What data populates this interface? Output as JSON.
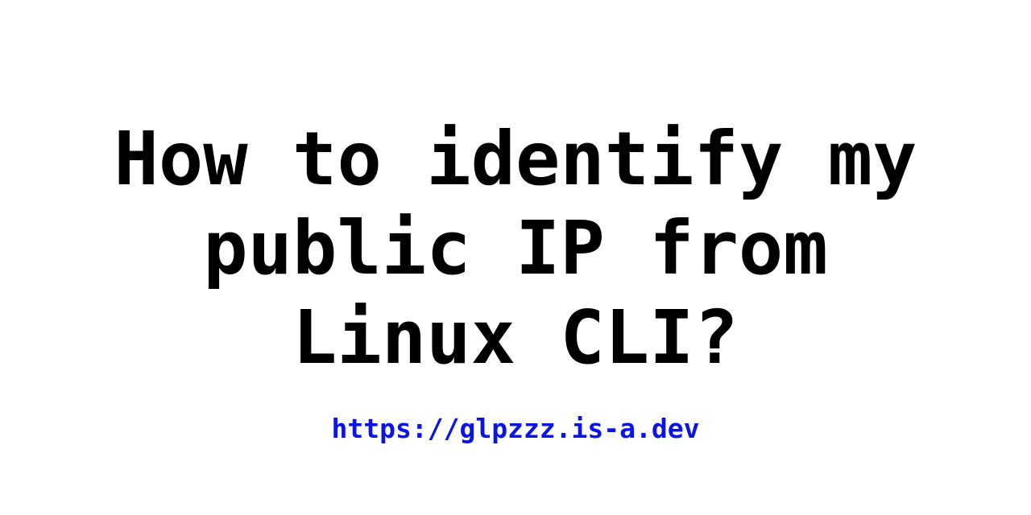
{
  "title": {
    "lines": [
      "How to identify my",
      "public IP from",
      "Linux CLI?"
    ],
    "color": "#000000"
  },
  "link": {
    "text": "https://glpzzz.is-a.dev",
    "color": "#0a14e6"
  },
  "background_color": "#ffffff"
}
